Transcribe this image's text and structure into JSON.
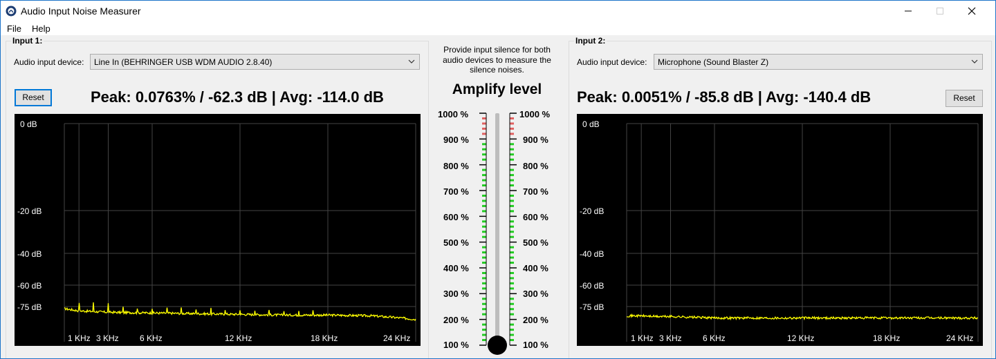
{
  "window": {
    "title": "Audio Input Noise Measurer"
  },
  "menu": [
    "File",
    "Help"
  ],
  "input1": {
    "group_label": "Input 1:",
    "device_label": "Audio input device:",
    "device_value": "Line In (BEHRINGER USB WDM AUDIO 2.8.40)",
    "reset_label": "Reset",
    "peak_text": "Peak: 0.0763% / -62.3 dB | Avg: -114.0 dB",
    "trace_color": "#ffff00"
  },
  "input2": {
    "group_label": "Input 2:",
    "device_label": "Audio input device:",
    "device_value": "Microphone (Sound Blaster Z)",
    "reset_label": "Reset",
    "peak_text": "Peak: 0.0051% / -85.8 dB | Avg: -140.4 dB",
    "trace_color": "#ffff00"
  },
  "spectrum_axes": {
    "y_ticks": [
      "0 dB",
      "-20 dB",
      "-40 dB",
      "-60 dB",
      "-75 dB"
    ],
    "x_ticks": [
      "1 KHz",
      "3 KHz",
      "6 KHz",
      "12 KHz",
      "18 KHz",
      "24 KHz"
    ]
  },
  "center": {
    "message": "Provide input silence for both audio devices to measure the silence noises.",
    "amplify_title": "Amplify level",
    "levels": [
      "1000 %",
      "900 %",
      "800 %",
      "700 %",
      "600 %",
      "500 %",
      "400 %",
      "300 %",
      "200 %",
      "100 %"
    ],
    "amplify_value_percent": 100,
    "colors": {
      "ok": "#22cc22",
      "warn": "#e06060"
    }
  },
  "chart_data": [
    {
      "type": "line",
      "title": "",
      "x_ticks_khz": [
        1,
        3,
        6,
        12,
        18,
        24
      ],
      "y_ticks_db": [
        0,
        -20,
        -40,
        -60,
        -75
      ],
      "ylim": [
        -85,
        0
      ],
      "xlim": [
        0,
        24
      ],
      "series": [
        {
          "x": [
            0,
            1,
            2,
            3,
            6,
            9,
            12,
            15,
            18,
            21,
            23,
            24
          ],
          "y": [
            -76.5,
            -78,
            -78.5,
            -79,
            -79.5,
            -80,
            -80.5,
            -81,
            -81,
            -81.5,
            -83,
            -84
          ]
        }
      ],
      "peaks_khz": [
        1,
        2,
        3,
        4,
        5,
        6,
        7,
        8,
        9,
        10,
        11,
        12,
        13,
        14,
        15,
        16,
        17
      ]
    },
    {
      "type": "line",
      "title": "",
      "x_ticks_khz": [
        1,
        3,
        6,
        12,
        18,
        24
      ],
      "y_ticks_db": [
        0,
        -20,
        -40,
        -60,
        -75
      ],
      "ylim": [
        -85,
        0
      ],
      "xlim": [
        0,
        24
      ],
      "series": [
        {
          "x": [
            0,
            1,
            2,
            3,
            6,
            9,
            12,
            15,
            18,
            21,
            24
          ],
          "y": [
            -81.5,
            -81.5,
            -82,
            -82,
            -83,
            -83,
            -83,
            -83,
            -83,
            -83,
            -83
          ]
        }
      ],
      "peaks_khz": []
    }
  ]
}
